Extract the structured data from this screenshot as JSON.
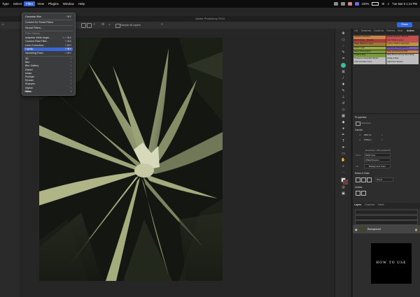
{
  "menubar": {
    "items": [
      "Type",
      "Select",
      "Filter",
      "View",
      "Plugins",
      "Window",
      "Help"
    ],
    "active_index": 2,
    "status": {
      "battery": "100%",
      "datetime": "Tue Mar 5  1:13 PM"
    }
  },
  "window": {
    "title": "Adobe Photoshop 2024"
  },
  "options_bar": {
    "sample_all_layers": "Sample All Layers",
    "share_label": "Share"
  },
  "filter_menu": {
    "items": [
      {
        "label": "Gaussian Blur",
        "shortcut": "^⌘F",
        "state": "normal"
      },
      {
        "label": "Convert for Smart Filters",
        "shortcut": "",
        "state": "normal"
      },
      {
        "label": "Neural Filters...",
        "shortcut": "",
        "state": "normal"
      },
      {
        "label": "Filter Gallery...",
        "shortcut": "",
        "state": "dim"
      },
      {
        "label": "Adaptive Wide Angle...",
        "shortcut": "⌥⇧⌘A",
        "state": "normal"
      },
      {
        "label": "Camera Raw Filter...",
        "shortcut": "⇧⌘A",
        "state": "normal"
      },
      {
        "label": "Lens Correction...",
        "shortcut": "⇧⌘R",
        "state": "normal"
      },
      {
        "label": "Liquify...",
        "shortcut": "⇧⌘X",
        "state": "highlighted"
      },
      {
        "label": "Vanishing Point...",
        "shortcut": "⌥⌘V",
        "state": "normal"
      },
      {
        "label": "3D",
        "shortcut": "›",
        "state": "normal"
      },
      {
        "label": "Blur",
        "shortcut": "›",
        "state": "normal"
      },
      {
        "label": "Blur Gallery",
        "shortcut": "›",
        "state": "normal"
      },
      {
        "label": "Distort",
        "shortcut": "›",
        "state": "normal"
      },
      {
        "label": "Noise",
        "shortcut": "›",
        "state": "normal"
      },
      {
        "label": "Pixelate",
        "shortcut": "›",
        "state": "normal"
      },
      {
        "label": "Render",
        "shortcut": "›",
        "state": "normal"
      },
      {
        "label": "Sharpen",
        "shortcut": "›",
        "state": "normal"
      },
      {
        "label": "Stylize",
        "shortcut": "›",
        "state": "normal"
      },
      {
        "label": "Video",
        "shortcut": "›",
        "state": "normal"
      },
      {
        "label": "Other",
        "shortcut": "›",
        "state": "normal"
      }
    ]
  },
  "right_panel": {
    "tabs": [
      "Libr",
      "Swatches",
      "Gradients",
      "Patterns",
      "Histo",
      "Actions"
    ],
    "active_tab": "Actions",
    "actions": [
      {
        "label": "Vignette (selection)",
        "color": "#c9864a"
      },
      {
        "label": "Frame Channel - 50 pixel",
        "color": "#c0504d"
      },
      {
        "label": "Wood Frame - 50 pixel",
        "color": "#a23d3a"
      },
      {
        "label": "Cast Shadow (type)",
        "color": "#c0504d"
      },
      {
        "label": "Water Reflection (type)",
        "color": "#9a7b3c"
      },
      {
        "label": "Custom RGB to Grayscale",
        "color": "#b59a3c"
      },
      {
        "label": "Molten Lead",
        "color": "#9bad3e"
      },
      {
        "label": "Make Clip Path (selection)",
        "color": "#7c58b8"
      },
      {
        "label": "Sepia Toning (layer)",
        "color": "#7a9c3b"
      },
      {
        "label": "Save as Photoshop PDF",
        "color": "#c9864a"
      },
      {
        "label": "Gradient Map",
        "color": "#7a9c3b"
      },
      {
        "label": "Mixer Brush Cloning Paint Setup",
        "color": "#bdbdbd"
      },
      {
        "label": "Frequency Separation Brush",
        "color": "#bdbdbd"
      },
      {
        "label": "Dodge & Burn",
        "color": "#bdbdbd"
      },
      {
        "label": "Color Contrast Curve",
        "color": "#bdbdbd"
      },
      {
        "label": "High Pass Sharpen",
        "color": "#bdbdbd"
      }
    ],
    "properties": {
      "title": "Properties",
      "document_label": "Document",
      "canvas_label": "Canvas",
      "width": "2827 px",
      "height": "3768 px",
      "resolution": "Resolution: 300 pixels/inch",
      "mode": "RGB Color",
      "bit_depth": "8 Bits/Channel",
      "fill": "Background Color",
      "rulers_title": "Rulers & Grids",
      "rulers_unit": "Pixels",
      "guides_title": "Guides"
    },
    "layers": {
      "tabs": [
        "Layers",
        "Channels",
        "Paths"
      ],
      "active_tab": "Layers",
      "rows": [
        {
          "name": "Background"
        }
      ]
    }
  },
  "watermark": {
    "text": "HOW TO USE"
  }
}
